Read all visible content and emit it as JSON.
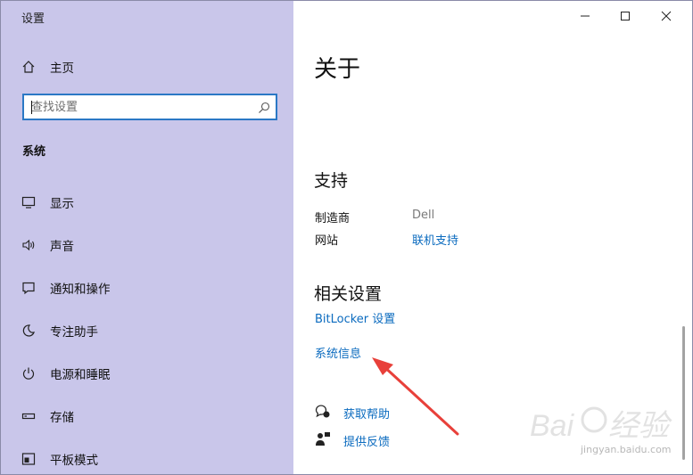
{
  "window": {
    "title": "设置",
    "controls": [
      "minimize-icon",
      "maximize-icon",
      "close-icon"
    ]
  },
  "sidebar": {
    "home_label": "主页",
    "search": {
      "placeholder": "查找设置"
    },
    "section_label": "系统",
    "items": [
      {
        "label": "显示",
        "icon": "monitor-icon"
      },
      {
        "label": "声音",
        "icon": "speaker-icon"
      },
      {
        "label": "通知和操作",
        "icon": "notification-icon"
      },
      {
        "label": "专注助手",
        "icon": "moon-icon"
      },
      {
        "label": "电源和睡眠",
        "icon": "power-icon"
      },
      {
        "label": "存储",
        "icon": "storage-icon"
      },
      {
        "label": "平板模式",
        "icon": "tablet-icon"
      }
    ]
  },
  "main": {
    "page_title": "关于",
    "support": {
      "heading": "支持",
      "rows": [
        {
          "label": "制造商",
          "value": "Dell"
        },
        {
          "label": "网站",
          "value": "联机支持"
        }
      ]
    },
    "related": {
      "heading": "相关设置",
      "links": [
        "BitLocker 设置",
        "系统信息"
      ]
    },
    "help_links": [
      {
        "label": "获取帮助",
        "icon": "help-chat-icon"
      },
      {
        "label": "提供反馈",
        "icon": "feedback-icon"
      }
    ]
  },
  "annotation": {
    "color": "#e8403a"
  },
  "watermark": {
    "brand": "Baidu经验",
    "url": "jingyan.baidu.com"
  },
  "colors": {
    "sidebar_bg": "#c9c6ea",
    "link": "#0b6bbf",
    "search_border": "#2b78c5"
  }
}
